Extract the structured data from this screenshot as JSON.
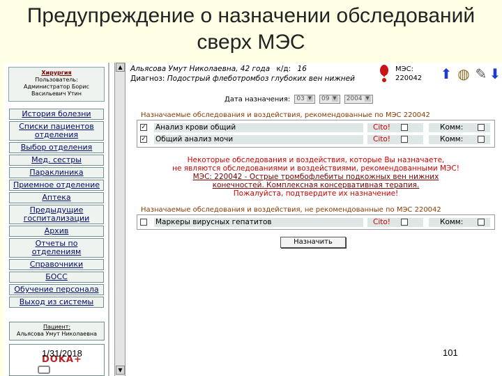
{
  "slide": {
    "title_line1": "Предупреждение о назначении обследований",
    "title_line2": "сверх МЭС",
    "date": "1/31/2018",
    "page_number": "101"
  },
  "nav": {
    "dept_name": "Хирургия",
    "dept_user_label": "Пользователь:",
    "dept_user_1": "Администратор Борис",
    "dept_user_2": "Васильевич Утин",
    "items": [
      {
        "label": "История болезни"
      },
      {
        "label": "Списки пациентов отделения"
      },
      {
        "label": "Выбор отделения"
      },
      {
        "label": "Мед. сестры"
      },
      {
        "label": "Параклиника"
      },
      {
        "label": "Приемное отделение"
      },
      {
        "label": "Аптека"
      },
      {
        "label": "Предыдущие госпитализации"
      },
      {
        "label": "Архив"
      },
      {
        "label": "Отчеты по отделениям"
      },
      {
        "label": "Справочники"
      },
      {
        "label": "БОСС"
      },
      {
        "label": "Обучение персонала"
      },
      {
        "label": "Выход из системы"
      }
    ],
    "patient_label": "Пациент:",
    "patient_name": "Альясова Умут Николаевна",
    "logo_text": "DOKA+"
  },
  "header": {
    "patient_full": "Альясова Умут Николаевна, 42 года",
    "kd_label": "к/д:",
    "kd_value": "16",
    "diagnosis_label": "Диагноз:",
    "diagnosis_value": "Подострый флеботромбоз глубоких вен нижней",
    "mes_label": "МЭС:",
    "mes_value": "220042"
  },
  "date_row": {
    "label": "Дата назначения:",
    "day": "03",
    "month": "09",
    "year": "2004"
  },
  "recommended": {
    "title": "Назначаемые обследования и воздействия, рекомендованные по МЭС 220042",
    "rows": [
      {
        "label": "Анализ крови общий",
        "checked": "✓",
        "cito": "Cito!",
        "komm": "Комм:"
      },
      {
        "label": "Общий анализ мочи",
        "checked": "✓",
        "cito": "Cito!",
        "komm": "Комм:"
      }
    ]
  },
  "warning": {
    "line1": "Некоторые обследования и воздействия, которые Вы назначаете,",
    "line2": "не являются обследованиями и воздействиями, рекомендованными МЭС!",
    "line3": "МЭС: 220042 - Острые тромбофлебиты подкожных вен нижних",
    "line4": "конечностей. Комплексная консервативная терапия.",
    "line5": "Пожалуйста, подтвердите их назначение!"
  },
  "not_recommended": {
    "title": "Назначаемые обследования и воздействия, не рекомендованные по МЭС 220042",
    "rows": [
      {
        "label": "Маркеры вирусных гепатитов",
        "checked": "",
        "cito": "Cito!",
        "komm": "Комм:"
      }
    ]
  },
  "submit_label": "Назначить",
  "colors": {
    "slide_bg": "#ffffe6",
    "warning_red": "#d00000",
    "section_title": "#8a3a00",
    "row_bg": "#dfe6e6"
  },
  "icons": [
    "exclamation-icon",
    "arrow-up-icon",
    "globe-icon",
    "edit-icon",
    "arrow-down-icon"
  ]
}
